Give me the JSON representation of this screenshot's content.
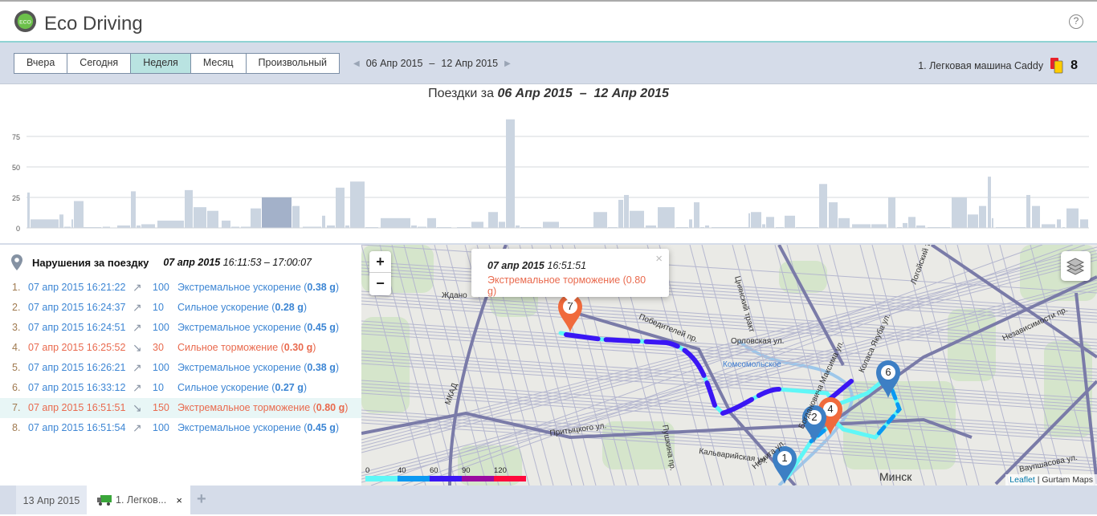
{
  "app": {
    "title": "Eco Driving",
    "help_icon": "help-icon"
  },
  "toolbar": {
    "periods": [
      {
        "label": "Вчера"
      },
      {
        "label": "Сегодня"
      },
      {
        "label": "Неделя",
        "active": true
      },
      {
        "label": "Месяц"
      },
      {
        "label": "Произвольный"
      }
    ],
    "range_from": "06 Апр 2015",
    "range_sep": "–",
    "range_to": "12 Апр 2015",
    "unit_name": "1. Легковая машина Caddy",
    "violations_count": "8"
  },
  "chart": {
    "title_prefix": "Поездки за",
    "title_range": "06 Апр 2015  –  12 Апр 2015"
  },
  "chart_data": {
    "type": "bar",
    "yticks": [
      "0",
      "25",
      "50",
      "75"
    ],
    "ylim": [
      0,
      95
    ],
    "grid": true,
    "bar_color": "#cbd5e1",
    "selected_color": "#a3b1c9",
    "selected_index": 20,
    "values": [
      29,
      7,
      11,
      1,
      7,
      22,
      0.5,
      1,
      2,
      30,
      2,
      3,
      6,
      31,
      17,
      14,
      6,
      1,
      1,
      16,
      25,
      18,
      1,
      10,
      2,
      33,
      2,
      38,
      0.5,
      8,
      2,
      1,
      8,
      0.5,
      0.5,
      5,
      13,
      5,
      89,
      2,
      0.5,
      5,
      0.5,
      13,
      0.5,
      23,
      27,
      14,
      2,
      17,
      0.5,
      7,
      21,
      0.5,
      2,
      0.5,
      12,
      13,
      3,
      9,
      0.5,
      10,
      0.5,
      36,
      21,
      8,
      3,
      3,
      25,
      0.5,
      4,
      9,
      2,
      0.5,
      25,
      11,
      18,
      42,
      8,
      0.5,
      27,
      18,
      3,
      7,
      0.5,
      16,
      7
    ]
  },
  "trip": {
    "heading": "Нарушения за поездку",
    "date": "07 апр 2015",
    "time": "16:11:53 – 17:00:07"
  },
  "violations": [
    {
      "n": "1.",
      "datetime": "07 апр 2015 16:21:22",
      "type": "accel",
      "value": "100",
      "label": "Экстремальное ускорение (",
      "g": "0.38 g",
      "close": ")"
    },
    {
      "n": "2.",
      "datetime": "07 апр 2015 16:24:37",
      "type": "accel",
      "value": "10",
      "label": "Сильное ускорение (",
      "g": "0.28 g",
      "close": ")"
    },
    {
      "n": "3.",
      "datetime": "07 апр 2015 16:24:51",
      "type": "accel",
      "value": "100",
      "label": "Экстремальное ускорение (",
      "g": "0.45 g",
      "close": ")"
    },
    {
      "n": "4.",
      "datetime": "07 апр 2015 16:25:52",
      "type": "brake",
      "value": "30",
      "label": "Сильное торможение (",
      "g": "0.30 g",
      "close": ")"
    },
    {
      "n": "5.",
      "datetime": "07 апр 2015 16:26:21",
      "type": "accel",
      "value": "100",
      "label": "Экстремальное ускорение (",
      "g": "0.38 g",
      "close": ")"
    },
    {
      "n": "6.",
      "datetime": "07 апр 2015 16:33:12",
      "type": "accel",
      "value": "10",
      "label": "Сильное ускорение (",
      "g": "0.27 g",
      "close": ")"
    },
    {
      "n": "7.",
      "datetime": "07 апр 2015 16:51:51",
      "type": "brake",
      "value": "150",
      "label": "Экстремальное торможение (",
      "g": "0.80 g",
      "close": ")",
      "selected": true
    },
    {
      "n": "8.",
      "datetime": "07 апр 2015 16:51:54",
      "type": "accel",
      "value": "100",
      "label": "Экстремальное ускорение (",
      "g": "0.45 g",
      "close": ")"
    }
  ],
  "map": {
    "zoom_in": "+",
    "zoom_out": "−",
    "popup": {
      "date": "07 апр 2015",
      "time": "16:51:51",
      "text": "Экстремальное торможение (0.80 g)",
      "close": "×"
    },
    "labels": [
      "Ждано",
      "Победителей пр.",
      "Орловская ул.",
      "Комсомольское",
      "МКАД",
      "Притыцкого ул.",
      "Пушкина пр.",
      "Кальварийская ул.",
      "Немига ул.",
      "Богдановича Максима ул.",
      "Коласа Якуба ул.",
      "Логойский тракт",
      "Независимости пр.",
      "Ваупшасова ул.",
      "Минск",
      "Цнянский тракт"
    ],
    "markers": [
      "1",
      "2",
      "4",
      "6",
      "7"
    ],
    "legend": {
      "ticks": [
        "0",
        "40",
        "60",
        "90",
        "120"
      ],
      "colors": [
        "#5ff7f7",
        "#0a99f2",
        "#3a16f4",
        "#9a0aa0",
        "#ff0a3c"
      ]
    },
    "attribution_link": "Leaflet",
    "attribution_sep": "|",
    "attribution_text": "Gurtam Maps"
  },
  "tabs": {
    "date_tab": "13 Апр 2015",
    "unit_tab": "1. Легков...",
    "close": "×",
    "add": "+"
  },
  "colors": {
    "accent": "#b9e3e1",
    "toolbar": "#d5dce9",
    "violation_blue": "#3d86d4",
    "violation_red": "#e96a4e",
    "marker_blue": "#3d7fc4",
    "marker_red": "#f06a3c"
  }
}
